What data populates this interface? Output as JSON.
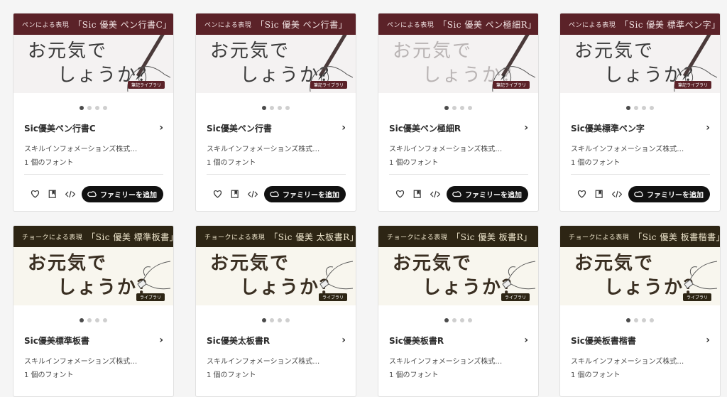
{
  "cards": [
    {
      "banner_prefix": "ペンによる表現",
      "banner_title": "「Sic 優美 ペン行書C」",
      "sample_line1": "お元気で",
      "sample_line2": "しょうか？",
      "tag": "筆記ライブラリ",
      "name": "Sic優美ペン行書C",
      "foundry": "スキルインフォメーションズ株式…",
      "count": "1 個のフォント",
      "add_label": "ファミリーを追加"
    },
    {
      "banner_prefix": "ペンによる表現",
      "banner_title": "「Sic 優美 ペン行書」",
      "sample_line1": "お元気で",
      "sample_line2": "しょうか？",
      "tag": "筆記ライブラリ",
      "name": "Sic優美ペン行書",
      "foundry": "スキルインフォメーションズ株式…",
      "count": "1 個のフォント",
      "add_label": "ファミリーを追加"
    },
    {
      "banner_prefix": "ペンによる表現",
      "banner_title": "「Sic 優美 ペン極細R」",
      "sample_line1": "お元気で",
      "sample_line2": "しょうか？",
      "tag": "筆記ライブラリ",
      "name": "Sic優美ペン極細R",
      "foundry": "スキルインフォメーションズ株式…",
      "count": "1 個のフォント",
      "add_label": "ファミリーを追加"
    },
    {
      "banner_prefix": "ペンによる表現",
      "banner_title": "「Sic 優美 標準ペン字」",
      "sample_line1": "お元気で",
      "sample_line2": "しょうか？",
      "tag": "筆記ライブラリ",
      "name": "Sic優美標準ペン字",
      "foundry": "スキルインフォメーションズ株式…",
      "count": "1 個のフォント",
      "add_label": "ファミリーを追加"
    },
    {
      "banner_prefix": "チョークによる表現",
      "banner_title": "「Sic 優美 標準板書」",
      "sample_line1": "お元気で",
      "sample_line2": "しょうか？",
      "tag": "ライブラリ",
      "name": "Sic優美標準板書",
      "foundry": "スキルインフォメーションズ株式…",
      "count": "1 個のフォント"
    },
    {
      "banner_prefix": "チョークによる表現",
      "banner_title": "「Sic 優美 太板書R」",
      "sample_line1": "お元気で",
      "sample_line2": "しょうか？",
      "tag": "ライブラリ",
      "name": "Sic優美太板書R",
      "foundry": "スキルインフォメーションズ株式…",
      "count": "1 個のフォント"
    },
    {
      "banner_prefix": "チョークによる表現",
      "banner_title": "「Sic 優美 板書R」",
      "sample_line1": "お元気で",
      "sample_line2": "しょうか？",
      "tag": "ライブラリ",
      "name": "Sic優美板書R",
      "foundry": "スキルインフォメーションズ株式…",
      "count": "1 個のフォント"
    },
    {
      "banner_prefix": "チョークによる表現",
      "banner_title": "「Sic 優美 板書楷書」",
      "sample_line1": "お元気で",
      "sample_line2": "しょうか？",
      "tag": "ライブラリ",
      "name": "Sic優美板書楷書",
      "foundry": "スキルインフォメーションズ株式…",
      "count": "1 個のフォント"
    }
  ],
  "colors": {
    "pen_banner": "#5b2228",
    "chalk_banner": "#2d2514",
    "button": "#111111",
    "dot_active": "#4b4b4b",
    "dot_inactive": "#cfcfcf"
  },
  "icons": {
    "favorite": "heart-icon",
    "web_project": "bookmark-icon",
    "embed": "code-icon",
    "creative_cloud": "creative-cloud-icon",
    "next": "chevron-right-icon"
  }
}
